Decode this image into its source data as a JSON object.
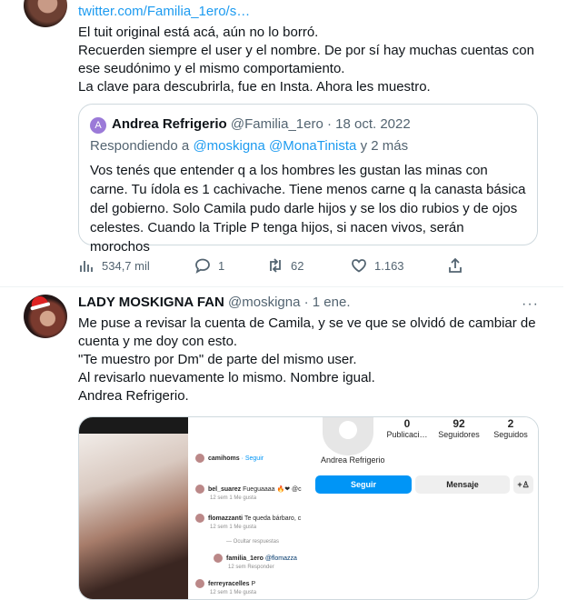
{
  "tweet1": {
    "link_text": "twitter.com/Familia_1ero/s…",
    "body": "El tuit original está acá, aún no lo borró.\nRecuerden siempre el user y el nombre. De por sí hay muchas cuentas con ese seudónimo y el mismo comportamiento.\nLa clave para descubrirla, fue en Insta. Ahora les muestro.",
    "quote": {
      "avatar_letter": "A",
      "name": "Andrea Refrigerio",
      "handle": "@Familia_1ero",
      "date": "· 18 oct. 2022",
      "replying_prefix": "Respondiendo a",
      "replying_mentions": "@moskigna @MonaTinista",
      "replying_suffix": "y 2 más",
      "text": "Vos tenés que entender q a los hombres les gustan las minas con carne. Tu ídola es 1 cachivache. Tiene menos carne q la canasta básica del gobierno. Solo Camila pudo darle hijos y se los dio rubios y de ojos celestes. Cuando la Triple P tenga hijos, si nacen vivos, serán morochos"
    },
    "actions": {
      "views": "534,7 mil",
      "replies": "1",
      "retweets": "62",
      "likes": "1.163"
    }
  },
  "tweet2": {
    "name": "LADY MOSKIGNA FAN",
    "handle": "@moskigna",
    "date": "· 1 ene.",
    "more": "···",
    "body": "Me puse a revisar la cuenta de Camila, y se ve que se olvidó de cambiar de cuenta y me doy con esto.\n\"Te muestro por Dm\" de parte del mismo user.\nAl revisarlo nuevamente lo mismo. Nombre igual.\nAndrea Refrigerio.",
    "media": {
      "comments": {
        "header_user": "camihoms",
        "header_follow": "· Seguir",
        "c1_user": "bel_suarez",
        "c1_text": "Fueguaaaa 🔥❤ @c",
        "c1_meta": "12 sem  1 Me gusta",
        "c2_user": "flomazzanti",
        "c2_text": "Te queda bárbaro, c",
        "c2_meta": "12 sem  1 Me gusta",
        "hide_replies": "— Ocultar respuestas",
        "c3_user": "familia_1ero",
        "c3_text": "@flomazza",
        "c3_meta": "12 sem  Responder",
        "c4_user": "ferreyracelles",
        "c4_text": "P",
        "c4_meta": "12 sem  1 Me gusta"
      },
      "profile": {
        "posts": "0",
        "posts_label": "Publicaci…",
        "followers": "92",
        "followers_label": "Seguidores",
        "following": "2",
        "following_label": "Seguidos",
        "name": "Andrea Refrigerio",
        "follow_btn": "Seguir",
        "message_btn": "Mensaje",
        "add_btn": "+♙"
      }
    }
  }
}
